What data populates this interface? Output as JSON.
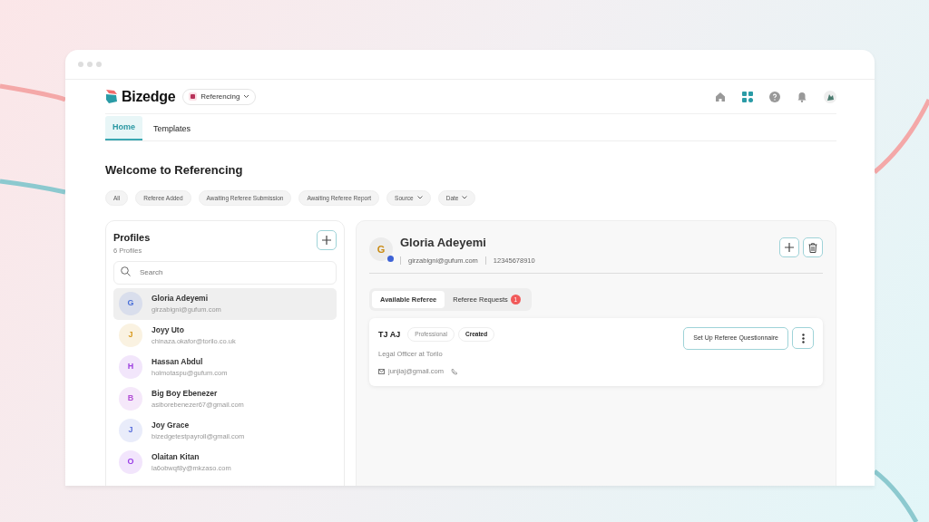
{
  "app": {
    "logo": "Bizedge",
    "module": "Referencing"
  },
  "tabs": [
    {
      "label": "Home",
      "selected": true
    },
    {
      "label": "Templates",
      "selected": false
    }
  ],
  "page_title": "Welcome to Referencing",
  "filters": [
    {
      "label": "All",
      "kind": "chip"
    },
    {
      "label": "Referee Added",
      "kind": "chip"
    },
    {
      "label": "Awaiting Referee Submission",
      "kind": "chip"
    },
    {
      "label": "Awaiting Referee Report",
      "kind": "chip"
    },
    {
      "label": "Source",
      "kind": "dropdown"
    },
    {
      "label": "Date",
      "kind": "dropdown"
    }
  ],
  "profiles": {
    "title": "Profiles",
    "count": "6 Profiles",
    "search": {
      "placeholder": "Search"
    },
    "items": [
      {
        "initial": "G",
        "name": "Gloria Adeyemi",
        "email": "girzabigni@gufum.com",
        "color": "#4a6fd8",
        "selected": true
      },
      {
        "initial": "J",
        "name": "Joyy Uto",
        "email": "chinaza.okafor@torilo.co.uk",
        "color": "#d99a1e",
        "selected": false
      },
      {
        "initial": "H",
        "name": "Hassan Abdul",
        "email": "holmotaspu@gufum.com",
        "color": "#a043e0",
        "selected": false
      },
      {
        "initial": "B",
        "name": "Big Boy Ebenezer",
        "email": "asiborebenezer67@gmail.com",
        "color": "#b34fd6",
        "selected": false
      },
      {
        "initial": "J",
        "name": "Joy Grace",
        "email": "bizedgetestpayroll@gmail.com",
        "color": "#5a6fdc",
        "selected": false
      },
      {
        "initial": "O",
        "name": "Olaitan Kitan",
        "email": "la6obwqf8y@mkzaso.com",
        "color": "#9a3fe6",
        "selected": false
      }
    ]
  },
  "detail": {
    "initial": "G",
    "name": "Gloria Adeyemi",
    "email": "girzabigni@gufum.com",
    "phone": "12345678910",
    "tabs": [
      {
        "label": "Available Referee",
        "selected": true
      },
      {
        "label": "Referee Requests",
        "badge": "1",
        "selected": false
      }
    ],
    "referees": [
      {
        "name": "TJ AJ",
        "tags": [
          {
            "label": "Professional",
            "kind": "type"
          },
          {
            "label": "Created",
            "kind": "status"
          }
        ],
        "role": "Legal Officer at Torilo",
        "email": "junjiaj@gmail.com",
        "action": "Set Up Referee Questionnaire"
      }
    ]
  }
}
